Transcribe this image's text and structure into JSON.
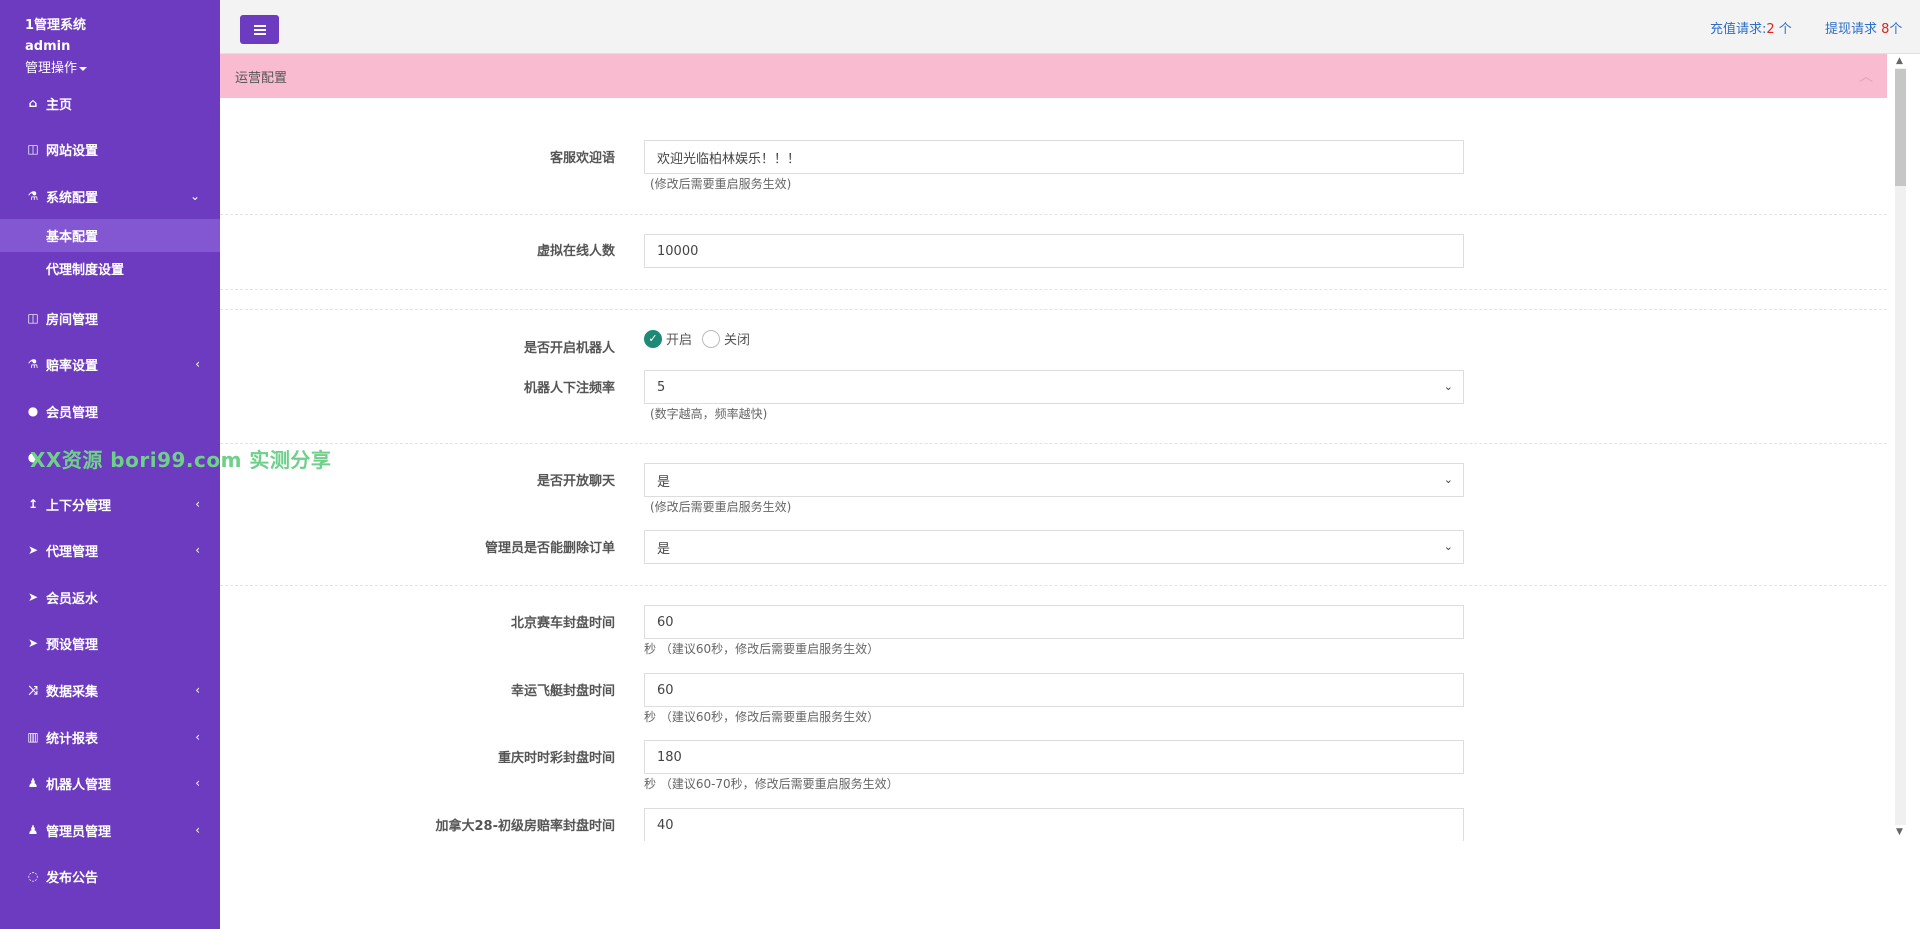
{
  "sidebar": {
    "brand": "1管理系统",
    "user": "admin",
    "user_menu": "管理操作",
    "items": [
      {
        "icon": "home-icon",
        "glyph": "⌂",
        "label": "主页"
      },
      {
        "icon": "columns-icon",
        "glyph": "◫",
        "label": "网站设置"
      },
      {
        "icon": "flask-icon",
        "glyph": "⚗",
        "label": "系统配置",
        "arrow": "⌄"
      },
      {
        "icon": "columns-icon",
        "glyph": "◫",
        "label": "房间管理"
      },
      {
        "icon": "flask-icon",
        "glyph": "⚗",
        "label": "赔率设置",
        "arrow": "‹"
      },
      {
        "icon": "user-icon",
        "glyph": "●",
        "label": "会员管理"
      },
      {
        "icon": "users-icon",
        "glyph": "●",
        "label": ""
      },
      {
        "icon": "level-up-icon",
        "glyph": "↥",
        "label": "上下分管理",
        "arrow": "‹"
      },
      {
        "icon": "paper-plane-icon",
        "glyph": "➤",
        "label": "代理管理",
        "arrow": "‹"
      },
      {
        "icon": "paper-plane-icon",
        "glyph": "➤",
        "label": "会员返水"
      },
      {
        "icon": "paper-plane-icon",
        "glyph": "➤",
        "label": "预设管理"
      },
      {
        "icon": "random-icon",
        "glyph": "⤨",
        "label": "数据采集",
        "arrow": "‹"
      },
      {
        "icon": "bar-chart-icon",
        "glyph": "▥",
        "label": "统计报表",
        "arrow": "‹"
      },
      {
        "icon": "male-icon",
        "glyph": "♟",
        "label": "机器人管理",
        "arrow": "‹"
      },
      {
        "icon": "male-icon",
        "glyph": "♟",
        "label": "管理员管理",
        "arrow": "‹"
      },
      {
        "icon": "comment-icon",
        "glyph": "◌",
        "label": "发布公告"
      }
    ],
    "sub_items": [
      "基本配置",
      "代理制度设置"
    ]
  },
  "topbar": {
    "recharge_label": "充值请求:",
    "recharge_count": "2",
    "recharge_unit": " 个",
    "withdraw_label": "提现请求 ",
    "withdraw_count": "8",
    "withdraw_unit": "个"
  },
  "panel": {
    "title": "运营配置",
    "collapse_glyph": "︿"
  },
  "form": {
    "welcome": {
      "label": "客服欢迎语",
      "value": "欢迎光临柏林娱乐！！！",
      "help": "(修改后需要重启服务生效)"
    },
    "online": {
      "label": "虚拟在线人数",
      "value": "10000"
    },
    "robot": {
      "label": "是否开启机器人",
      "on": "开启",
      "off": "关闭"
    },
    "robot_freq": {
      "label": "机器人下注频率",
      "value": "5",
      "help": "(数字越高，频率越快)"
    },
    "chat": {
      "label": "是否开放聊天",
      "value": "是",
      "help": "(修改后需要重启服务生效)"
    },
    "delete_order": {
      "label": "管理员是否能删除订单",
      "value": "是"
    },
    "bj_close": {
      "label": "北京赛车封盘时间",
      "value": "60",
      "help": "秒 （建议60秒，修改后需要重启服务生效）"
    },
    "xy_close": {
      "label": "幸运飞艇封盘时间",
      "value": "60",
      "help": "秒 （建议60秒，修改后需要重启服务生效）"
    },
    "cq_close": {
      "label": "重庆时时彩封盘时间",
      "value": "180",
      "help": "秒 （建议60-70秒，修改后需要重启服务生效）"
    },
    "jnd_close": {
      "label": "加拿大28-初级房赔率封盘时间",
      "value": "40"
    }
  },
  "watermark": "XX资源 bori99.com 实测分享",
  "colors": {
    "sidebar": "#6c3bbf",
    "panel_head": "#f9bbd0",
    "link": "#2d6ec9",
    "radio_checked": "#1e8a76"
  }
}
